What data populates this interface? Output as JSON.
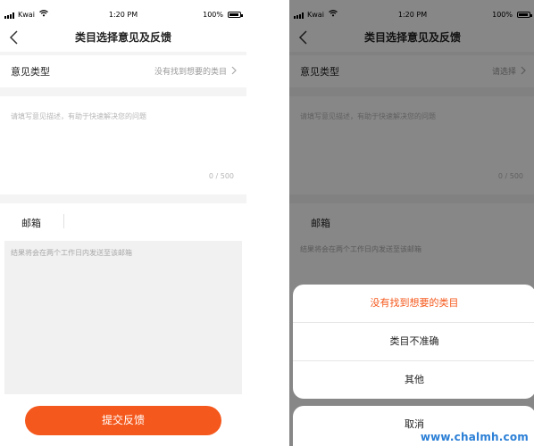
{
  "colors": {
    "accent": "#f5581c",
    "watermark": "#2b7fd6"
  },
  "status_bar": {
    "carrier": "Kwai",
    "time": "1:20 PM",
    "battery": "100%"
  },
  "nav": {
    "title": "类目选择意见及反馈",
    "back_icon": "chevron-left-icon"
  },
  "left_screen": {
    "feedback_type": {
      "label": "意见类型",
      "value": "没有找到想要的类目"
    },
    "description": {
      "placeholder": "请填写意见描述，有助于快速解决您的问题",
      "counter": "0 / 500"
    },
    "email": {
      "label": "邮箱",
      "hint": "结果将会在两个工作日内发送至该邮箱"
    },
    "submit_label": "提交反馈"
  },
  "right_screen": {
    "feedback_type": {
      "label": "意见类型",
      "value": "请选择"
    },
    "description": {
      "placeholder": "请填写意见描述，有助于快速解决您的问题",
      "counter": "0 / 500"
    },
    "email": {
      "label": "邮箱",
      "hint": "结果将会在两个工作日内发送至该邮箱"
    },
    "action_sheet": {
      "options": [
        "没有找到想要的类目",
        "类目不准确",
        "其他"
      ],
      "cancel": "取消"
    }
  },
  "watermark": "www.chalmh.com"
}
